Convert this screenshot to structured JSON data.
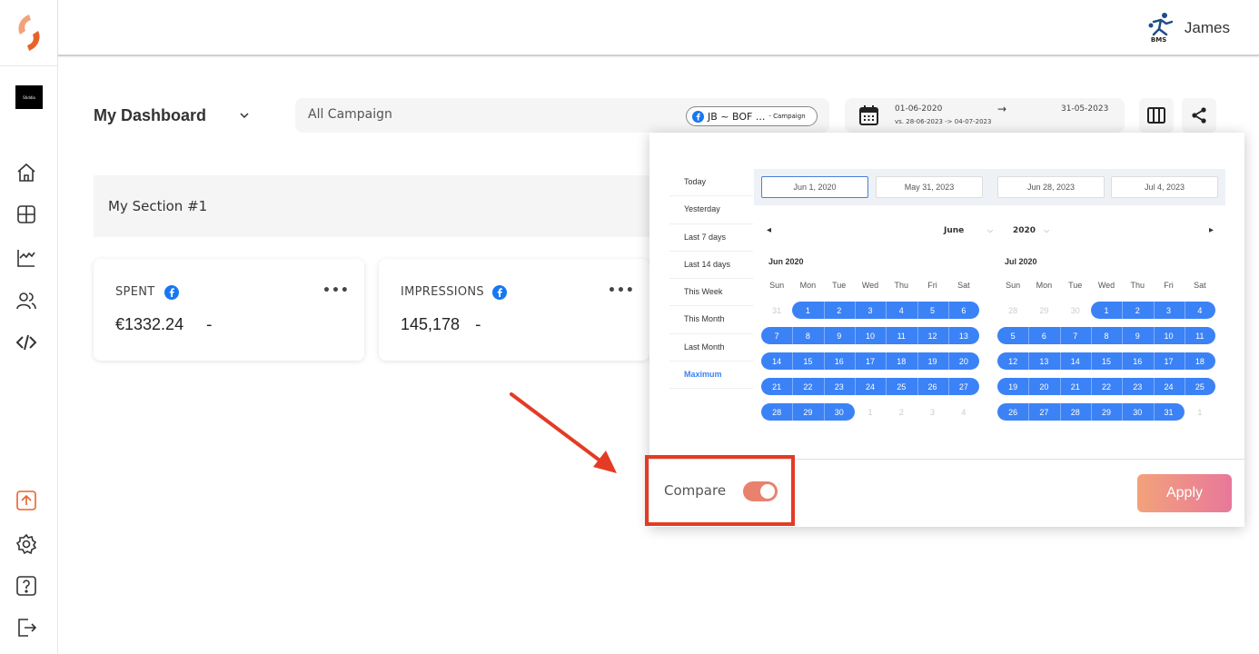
{
  "brand": {
    "workspace": "Stiddio"
  },
  "user": {
    "name": "James",
    "logo_text": "BMS"
  },
  "dashboard": {
    "title": "My Dashboard",
    "campaign_label": "All Campaign",
    "campaign_chip": "JB ~ BOF ...",
    "campaign_chip_suffix": "- Campaign",
    "date_start": "01-06-2020",
    "date_arrow": "→",
    "date_end": "31-05-2023",
    "date_vs": "vs. 28-06-2023 -> 04-07-2023"
  },
  "section": {
    "title": "My Section #1"
  },
  "cards": [
    {
      "label": "SPENT",
      "value": "€1332.24",
      "delta": "-"
    },
    {
      "label": "IMPRESSIONS",
      "value": "145,178",
      "delta": "-"
    }
  ],
  "datepicker": {
    "presets": [
      "Today",
      "Yesterday",
      "Last 7 days",
      "Last 14 days",
      "This Week",
      "This Month",
      "Last Month",
      "Maximum"
    ],
    "active_preset": "Maximum",
    "inputs": [
      "Jun 1, 2020",
      "May 31, 2023",
      "Jun 28, 2023",
      "Jul 4, 2023"
    ],
    "month_select": "June",
    "year_select": "2020",
    "prev": "◂",
    "next": "▸",
    "weekdays": [
      "Sun",
      "Mon",
      "Tue",
      "Wed",
      "Thu",
      "Fri",
      "Sat"
    ],
    "months": [
      {
        "title": "Jun 2020",
        "rows": [
          [
            "31",
            "1",
            "2",
            "3",
            "4",
            "5",
            "6"
          ],
          [
            "7",
            "8",
            "9",
            "10",
            "11",
            "12",
            "13"
          ],
          [
            "14",
            "15",
            "16",
            "17",
            "18",
            "19",
            "20"
          ],
          [
            "21",
            "22",
            "23",
            "24",
            "25",
            "26",
            "27"
          ],
          [
            "28",
            "29",
            "30",
            "1",
            "2",
            "3",
            "4"
          ]
        ]
      },
      {
        "title": "Jul 2020",
        "rows": [
          [
            "28",
            "29",
            "30",
            "1",
            "2",
            "3",
            "4"
          ],
          [
            "5",
            "6",
            "7",
            "8",
            "9",
            "10",
            "11"
          ],
          [
            "12",
            "13",
            "14",
            "15",
            "16",
            "17",
            "18"
          ],
          [
            "19",
            "20",
            "21",
            "22",
            "23",
            "24",
            "25"
          ],
          [
            "26",
            "27",
            "28",
            "29",
            "30",
            "31",
            "1"
          ]
        ]
      }
    ],
    "compare_label": "Compare",
    "compare_enabled": true,
    "apply_label": "Apply"
  },
  "colors": {
    "accent": "#3b82f6",
    "brand_orange": "#e8826f",
    "annotation_red": "#e43b25"
  }
}
